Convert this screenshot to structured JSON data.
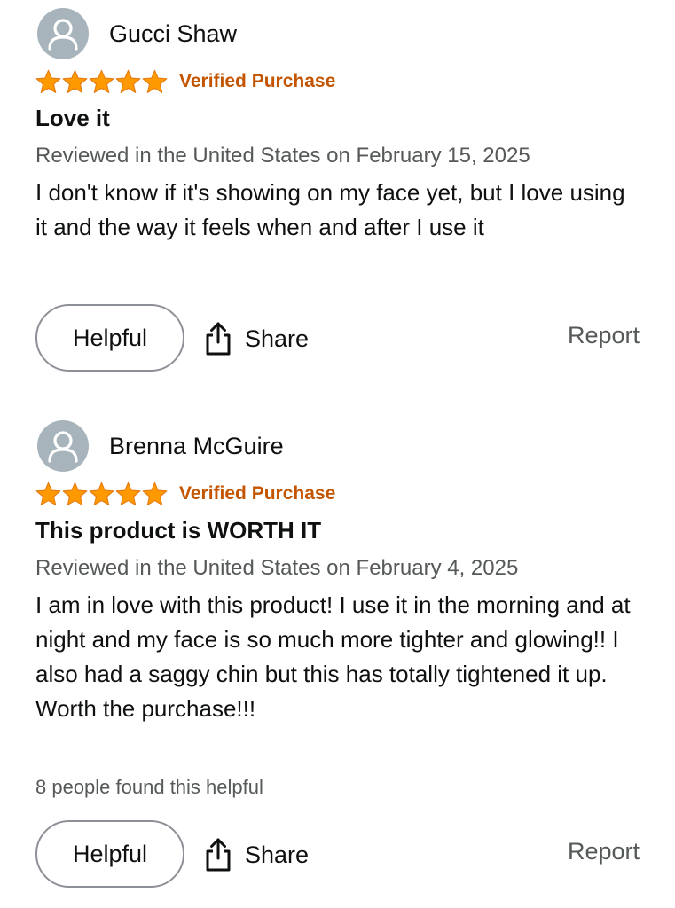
{
  "reviews": [
    {
      "reviewer": "Gucci Shaw",
      "rating": 5,
      "verified_label": "Verified Purchase",
      "title": "Love it",
      "date_line": "Reviewed in the United States on February 15, 2025",
      "body": "I don't know if it's showing on my face yet, but I love using it and the way it feels when and after I use it",
      "helpful_count_text": "",
      "helpful_label": "Helpful",
      "share_label": "Share",
      "report_label": "Report"
    },
    {
      "reviewer": "Brenna McGuire",
      "rating": 5,
      "verified_label": "Verified Purchase",
      "title": "This product is WORTH IT",
      "date_line": "Reviewed in the United States on February 4, 2025",
      "body": "I am in love with this product! I use it in the morning and at night and my face is so much more tighter and glowing!! I also had a saggy chin but this has totally tightened it up. Worth the purchase!!!",
      "helpful_count_text": "8 people found this helpful",
      "helpful_label": "Helpful",
      "share_label": "Share",
      "report_label": "Report"
    }
  ],
  "colors": {
    "star": "#ff9900",
    "verified": "#c45500",
    "avatar_bg": "#a8b4bb",
    "secondary_text": "#565959"
  },
  "icons": {
    "avatar": "user-silhouette-icon",
    "star": "star-icon",
    "share": "share-icon"
  }
}
